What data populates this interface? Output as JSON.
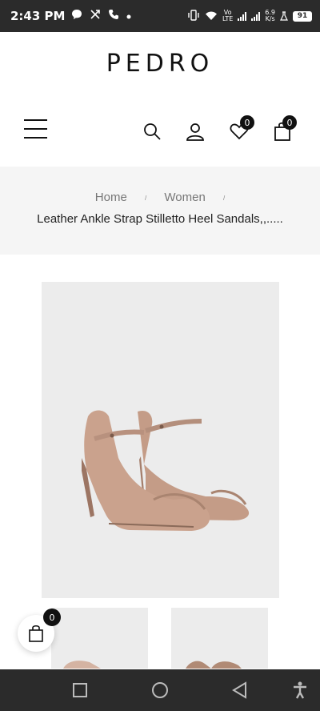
{
  "status_bar": {
    "time": "2:43 PM",
    "net_speed_value": "6.9",
    "net_speed_unit": "K/s",
    "network_type_top": "Vo",
    "network_type_bottom": "LTE",
    "battery": "91",
    "icons": [
      "chat-bubble-icon",
      "missed-call-icon",
      "phone-icon",
      "dot-icon",
      "vibrate-icon",
      "wifi-icon",
      "signal-icon",
      "signal-icon",
      "flask-icon",
      "battery-icon"
    ]
  },
  "header": {
    "brand": "PEDRO",
    "wishlist_count": "0",
    "cart_count": "0",
    "icons": [
      "menu-icon",
      "search-icon",
      "user-icon",
      "heart-icon",
      "shopping-bag-icon"
    ]
  },
  "breadcrumb": {
    "items": [
      "Home",
      "Women"
    ],
    "separator": "/",
    "current": "Leather Ankle Strap Stilletto Heel Sandals,,....."
  },
  "floating_cart": {
    "count": "0"
  },
  "colors": {
    "status_bar_bg": "#2b2b2b",
    "breadcrumb_bg": "#f5f5f5",
    "product_bg": "#ececec",
    "shoe_color": "#c79f8a",
    "badge_bg": "#111111"
  },
  "android_nav": {
    "icons": [
      "square-recents-icon",
      "circle-home-icon",
      "triangle-back-icon",
      "accessibility-icon"
    ]
  }
}
